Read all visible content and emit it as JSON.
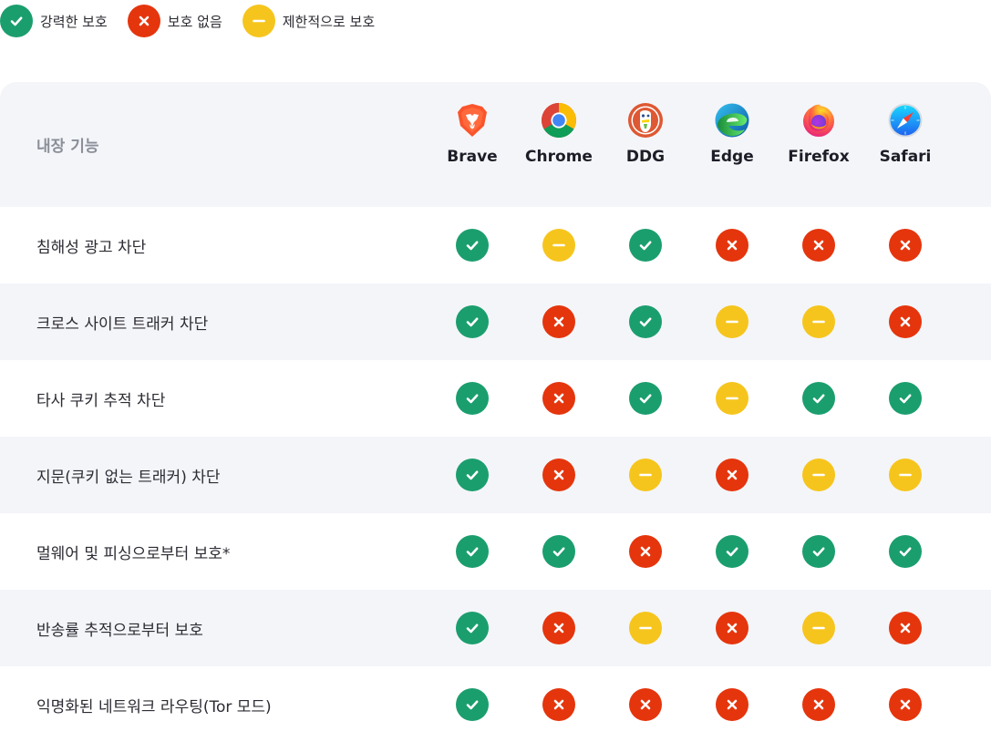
{
  "legend": [
    {
      "status": "yes",
      "label": "강력한 보호"
    },
    {
      "status": "no",
      "label": "보호 없음"
    },
    {
      "status": "limited",
      "label": "제한적으로 보호"
    }
  ],
  "table": {
    "feature_header": "내장 기능",
    "browsers": [
      {
        "id": "brave",
        "name": "Brave",
        "icon": "brave-lion-icon"
      },
      {
        "id": "chrome",
        "name": "Chrome",
        "icon": "chrome-icon"
      },
      {
        "id": "ddg",
        "name": "DDG",
        "icon": "duckduckgo-icon"
      },
      {
        "id": "edge",
        "name": "Edge",
        "icon": "edge-icon"
      },
      {
        "id": "firefox",
        "name": "Firefox",
        "icon": "firefox-icon"
      },
      {
        "id": "safari",
        "name": "Safari",
        "icon": "safari-compass-icon"
      }
    ],
    "rows": [
      {
        "label": "침해성 광고 차단",
        "values": [
          "yes",
          "limited",
          "yes",
          "no",
          "no",
          "no"
        ]
      },
      {
        "label": "크로스 사이트 트래커 차단",
        "values": [
          "yes",
          "no",
          "yes",
          "limited",
          "limited",
          "no"
        ]
      },
      {
        "label": "타사 쿠키 추적 차단",
        "values": [
          "yes",
          "no",
          "yes",
          "limited",
          "yes",
          "yes"
        ]
      },
      {
        "label": "지문(쿠키 없는 트래커) 차단",
        "values": [
          "yes",
          "no",
          "limited",
          "no",
          "limited",
          "limited"
        ]
      },
      {
        "label": "멀웨어 및 피싱으로부터 보호*",
        "values": [
          "yes",
          "yes",
          "no",
          "yes",
          "yes",
          "yes"
        ]
      },
      {
        "label": "반송률 추적으로부터 보호",
        "values": [
          "yes",
          "no",
          "limited",
          "no",
          "limited",
          "no"
        ]
      },
      {
        "label": "익명화된 네트워크 라우팅(Tor 모드)",
        "values": [
          "yes",
          "no",
          "no",
          "no",
          "no",
          "no"
        ]
      }
    ]
  },
  "colors": {
    "yes": "#1b9e6e",
    "no": "#e5350d",
    "limited": "#f6c51d",
    "row_alt": "#f4f5f9"
  }
}
